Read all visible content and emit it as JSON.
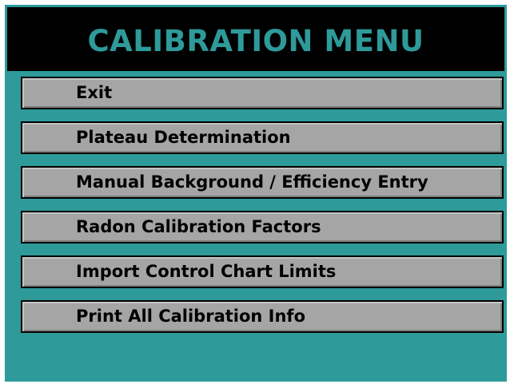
{
  "window": {
    "title": "CALIBRATION MENU",
    "colors": {
      "background": "#2e9a9a",
      "title_bar": "#000000",
      "title_text": "#2e9a9a",
      "button_face": "#a5a5a5",
      "button_text": "#000000"
    }
  },
  "menu": {
    "items": [
      {
        "label": "Exit"
      },
      {
        "label": "Plateau Determination"
      },
      {
        "label": "Manual Background / Efficiency Entry"
      },
      {
        "label": "Radon Calibration Factors"
      },
      {
        "label": "Import Control Chart Limits"
      },
      {
        "label": "Print All Calibration Info"
      }
    ]
  }
}
